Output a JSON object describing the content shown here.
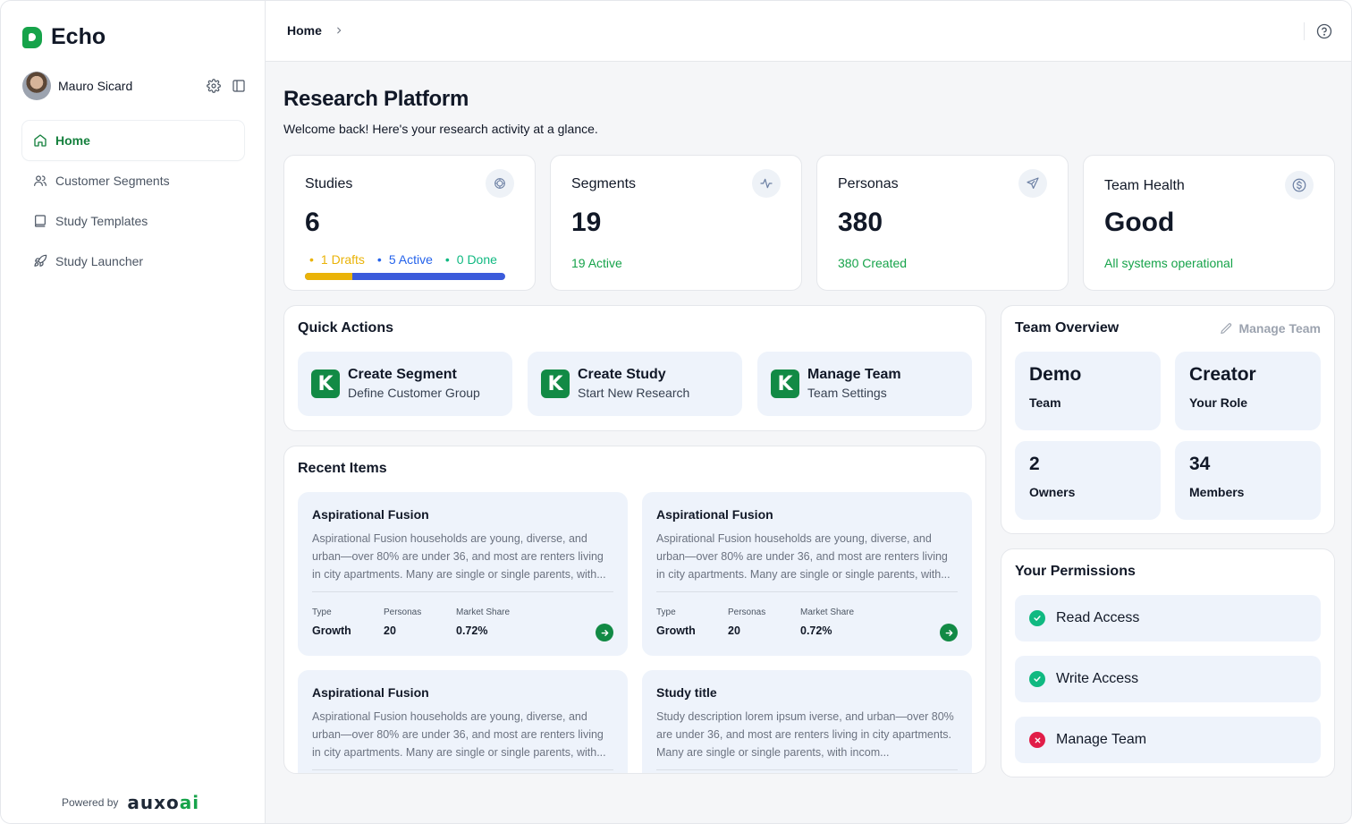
{
  "app": {
    "name": "Echo"
  },
  "user": {
    "name": "Mauro Sicard"
  },
  "nav": [
    {
      "label": "Home",
      "icon": "home-icon"
    },
    {
      "label": "Customer Segments",
      "icon": "users-icon"
    },
    {
      "label": "Study Templates",
      "icon": "book-icon"
    },
    {
      "label": "Study Launcher",
      "icon": "rocket-icon"
    }
  ],
  "footer": {
    "powered": "Powered by",
    "brand": "auxo",
    "brand_accent": "ai"
  },
  "breadcrumb": {
    "current": "Home"
  },
  "page": {
    "title": "Research Platform",
    "subtitle": "Welcome back! Here's your research activity at a glance."
  },
  "stats": {
    "studies": {
      "label": "Studies",
      "value": "6",
      "drafts": "1 Drafts",
      "active": "5 Active",
      "done": "0 Done",
      "drafts_fraction": 0.2366
    },
    "segments": {
      "label": "Segments",
      "value": "19",
      "note": "19 Active"
    },
    "personas": {
      "label": "Personas",
      "value": "380",
      "note": "380 Created"
    },
    "health": {
      "label": "Team Health",
      "value": "Good",
      "note": "All systems operational"
    }
  },
  "quick_actions": {
    "title": "Quick Actions",
    "items": [
      {
        "title": "Create Segment",
        "sub": "Define Customer Group",
        "badge": "K"
      },
      {
        "title": "Create Study",
        "sub": "Start New Research",
        "badge": "K"
      },
      {
        "title": "Manage Team",
        "sub": "Team Settings",
        "badge": "K"
      }
    ]
  },
  "recent": {
    "title": "Recent Items",
    "items": [
      {
        "title": "Aspirational Fusion",
        "desc": "Aspirational Fusion households are young, diverse, and urban—over 80% are under 36, and most are renters living in city apartments. Many are single or single parents, with...",
        "type_k": "Type",
        "type": "Growth",
        "personas_k": "Personas",
        "personas": "20",
        "share_k": "Market Share",
        "share": "0.72%"
      },
      {
        "title": "Aspirational Fusion",
        "desc": "Aspirational Fusion households are young, diverse, and urban—over 80% are under 36, and most are renters living in city apartments. Many are single or single parents, with...",
        "type_k": "Type",
        "type": "Growth",
        "personas_k": "Personas",
        "personas": "20",
        "share_k": "Market Share",
        "share": "0.72%"
      },
      {
        "title": "Aspirational Fusion",
        "desc": "Aspirational Fusion households are young, diverse, and urban—over 80% are under 36, and most are renters living in city apartments. Many are single or single parents, with..."
      },
      {
        "title": "Study title",
        "desc": "Study description lorem ipsum iverse, and urban—over 80% are under 36, and most are renters living in city apartments. Many are single or single parents, with incom..."
      }
    ]
  },
  "team": {
    "title": "Team Overview",
    "manage": "Manage Team",
    "tiles": [
      {
        "value": "Demo",
        "label": "Team"
      },
      {
        "value": "Creator",
        "label": "Your Role"
      },
      {
        "value": "2",
        "label": "Owners"
      },
      {
        "value": "34",
        "label": "Members"
      }
    ]
  },
  "permissions": {
    "title": "Your Permissions",
    "items": [
      {
        "label": "Read Access",
        "granted": true
      },
      {
        "label": "Write Access",
        "granted": true
      },
      {
        "label": "Manage Team",
        "granted": false
      }
    ]
  },
  "colors": {
    "brand": "#16a34a",
    "accent_dark": "#128a45",
    "draft": "#eab308",
    "active": "#3b5bdb",
    "done": "#10b981",
    "deny": "#e11d48"
  }
}
